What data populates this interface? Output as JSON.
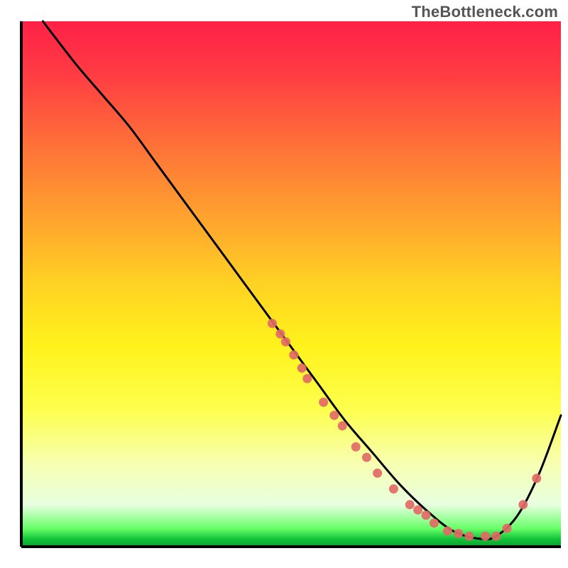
{
  "watermark": {
    "text": "TheBottleneck.com"
  },
  "chart_data": {
    "type": "line",
    "title": "",
    "xlabel": "",
    "ylabel": "",
    "xlim": [
      0,
      100
    ],
    "ylim": [
      0,
      100
    ],
    "grid": false,
    "legend": false,
    "background_gradient": {
      "stops": [
        {
          "offset": 0.0,
          "color": "#ff2147"
        },
        {
          "offset": 0.1,
          "color": "#ff3b43"
        },
        {
          "offset": 0.22,
          "color": "#ff6b3a"
        },
        {
          "offset": 0.35,
          "color": "#ff9a30"
        },
        {
          "offset": 0.5,
          "color": "#ffd223"
        },
        {
          "offset": 0.62,
          "color": "#fff31c"
        },
        {
          "offset": 0.74,
          "color": "#fdff4e"
        },
        {
          "offset": 0.84,
          "color": "#f7ffb0"
        },
        {
          "offset": 0.92,
          "color": "#e8ffe0"
        },
        {
          "offset": 0.965,
          "color": "#69ff69"
        },
        {
          "offset": 0.985,
          "color": "#14c43a"
        },
        {
          "offset": 1.0,
          "color": "#0aa02c"
        }
      ]
    },
    "series": [
      {
        "name": "bottleneck-curve",
        "color": "#000000",
        "x": [
          4,
          10,
          15,
          20,
          25,
          30,
          35,
          40,
          45,
          50,
          55,
          60,
          65,
          70,
          75,
          80,
          85,
          88,
          92,
          96,
          100
        ],
        "y": [
          100,
          92,
          86,
          80,
          73,
          66,
          59,
          52,
          45,
          38,
          31,
          24,
          18,
          12,
          7,
          3,
          1.5,
          2,
          6,
          14,
          25
        ]
      }
    ],
    "markers": {
      "color": "#e26a66",
      "points": [
        {
          "x": 46.5,
          "y": 42.5
        },
        {
          "x": 48.0,
          "y": 40.5
        },
        {
          "x": 49.0,
          "y": 39.0
        },
        {
          "x": 50.5,
          "y": 36.5
        },
        {
          "x": 52.0,
          "y": 34.0
        },
        {
          "x": 53.0,
          "y": 32.0
        },
        {
          "x": 56.0,
          "y": 27.5
        },
        {
          "x": 58.0,
          "y": 25.0
        },
        {
          "x": 59.5,
          "y": 23.0
        },
        {
          "x": 62.0,
          "y": 19.0
        },
        {
          "x": 64.0,
          "y": 17.0
        },
        {
          "x": 66.0,
          "y": 14.0
        },
        {
          "x": 69.0,
          "y": 11.0
        },
        {
          "x": 72.0,
          "y": 8.0
        },
        {
          "x": 73.5,
          "y": 7.0
        },
        {
          "x": 75.0,
          "y": 6.0
        },
        {
          "x": 76.5,
          "y": 4.5
        },
        {
          "x": 79.0,
          "y": 3.0
        },
        {
          "x": 81.0,
          "y": 2.5
        },
        {
          "x": 83.0,
          "y": 2.0
        },
        {
          "x": 86.0,
          "y": 2.0
        },
        {
          "x": 88.0,
          "y": 2.0
        },
        {
          "x": 90.0,
          "y": 3.5
        },
        {
          "x": 93.0,
          "y": 8.0
        },
        {
          "x": 95.5,
          "y": 13.0
        }
      ]
    }
  }
}
